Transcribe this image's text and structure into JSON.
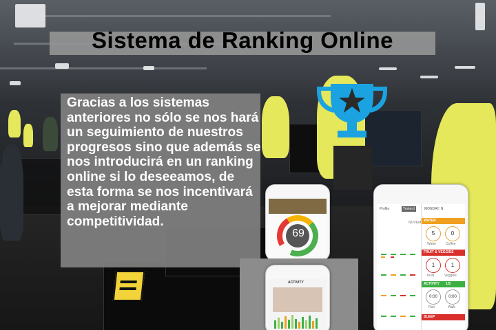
{
  "slide": {
    "title": "Sistema de Ranking Online",
    "body": "Gracias a los sistemas anteriores no sólo se nos hará un seguimiento de nuestros progresos sino que además se nos introducirá en un ranking online si lo deseeamos, de esta forma se nos incentivará a mejorar mediante competitividad."
  },
  "phone_score": {
    "score": "69"
  },
  "phone_tracker": {
    "tab_profile": "Profile",
    "tab_yesterday": "Yesterd",
    "date_label": "MONDAY, N",
    "month_label": "NOVEMBE",
    "sections": [
      "WATER",
      "FRUIT & VEGGIES",
      "ACTIVITY",
      "SLEEP"
    ],
    "goal_labels": [
      "Water",
      "Coffee",
      "Fruit",
      "Veggies",
      "Run",
      "Walk"
    ],
    "goal_values": [
      "5",
      "0",
      "1",
      "1",
      "0:00",
      "0:00"
    ],
    "activity_value": "1/5"
  },
  "phone_activity": {
    "header": "ACTIVITY"
  },
  "colors": {
    "trophy": "#1aa3e0",
    "star": "#2a2a2a",
    "score_ring_green": "#4caf50",
    "score_ring_red": "#e53935",
    "tracker_orange": "#f0a020",
    "tracker_green": "#3cb043",
    "tracker_red": "#d9302b",
    "person_shirt": "#e5e85a"
  }
}
